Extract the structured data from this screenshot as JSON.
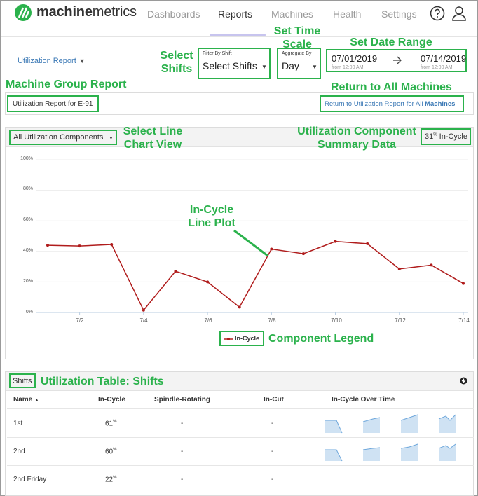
{
  "brand": {
    "name_bold": "machine",
    "name_rest": "metrics"
  },
  "nav": {
    "items": [
      "Dashboards",
      "Reports",
      "Machines",
      "Health",
      "Settings"
    ],
    "active": "Reports"
  },
  "controls": {
    "report_dropdown": "Utilization Report",
    "shift_filter": {
      "label": "Filter By Shift",
      "value": "Select Shifts"
    },
    "aggregate": {
      "label": "Aggregate By",
      "value": "Day"
    },
    "date_range": {
      "start_date": "07/01/2019",
      "start_time": "from 12:00 AM",
      "end_date": "07/14/2019",
      "end_time": "from 12:00 AM"
    }
  },
  "group_report": {
    "title": "Utilization Report for E-91",
    "return_link_prefix": "Return to Utilization Report for All ",
    "return_link_bold": "Machines"
  },
  "chart_panel": {
    "view_select": "All Utilization Components",
    "summary_value": "31",
    "summary_unit": "%",
    "summary_label": "In-Cycle"
  },
  "chart_data": {
    "type": "line",
    "x": [
      "7/1",
      "7/2",
      "7/3",
      "7/4",
      "7/5",
      "7/6",
      "7/7",
      "7/8",
      "7/9",
      "7/10",
      "7/11",
      "7/12",
      "7/13",
      "7/14"
    ],
    "x_tick_labels": [
      "7/2",
      "7/4",
      "7/6",
      "7/8",
      "7/10",
      "7/12",
      "7/14"
    ],
    "series": [
      {
        "name": "In-Cycle",
        "color": "#b01c1c",
        "values": [
          44,
          43.5,
          44.5,
          1.5,
          27,
          20,
          3.5,
          41.5,
          38.5,
          46.5,
          45,
          28.5,
          31,
          19
        ]
      }
    ],
    "ylim": [
      0,
      100
    ],
    "y_tick_labels": [
      "0%",
      "20%",
      "40%",
      "60%",
      "80%",
      "100%"
    ],
    "grid": true,
    "legend": "bottom-center"
  },
  "table": {
    "group_button": "Shifts",
    "columns": [
      "Name",
      "In-Cycle",
      "Spindle-Rotating",
      "In-Cut",
      "In-Cycle Over Time"
    ],
    "rows": [
      {
        "name": "1st",
        "in_cycle": "61",
        "spindle": "-",
        "in_cut": "-"
      },
      {
        "name": "2nd",
        "in_cycle": "60",
        "spindle": "-",
        "in_cut": "-"
      },
      {
        "name": "2nd Friday",
        "in_cycle": "22",
        "spindle": "-",
        "in_cut": "-"
      }
    ],
    "pct": "%"
  },
  "callouts": {
    "select_shifts": [
      "Select",
      "Shifts"
    ],
    "set_time_scale": [
      "Set Time",
      "Scale"
    ],
    "set_date_range": "Set Date Range",
    "machine_group_report": "Machine Group Report",
    "return_all": "Return to All Machines",
    "select_line_view": [
      "Select Line",
      "Chart View"
    ],
    "summary_data": [
      "Utilization Component",
      "Summary Data"
    ],
    "in_cycle_plot": [
      "In-Cycle",
      "Line Plot"
    ],
    "component_legend": "Component Legend",
    "utilization_table": "Utilization Table: Shifts"
  },
  "colors": {
    "accent_green": "#2bb24c",
    "link_blue": "#3a78b5",
    "series_red": "#b01c1c",
    "nav_underline": "#c7c4ee"
  }
}
